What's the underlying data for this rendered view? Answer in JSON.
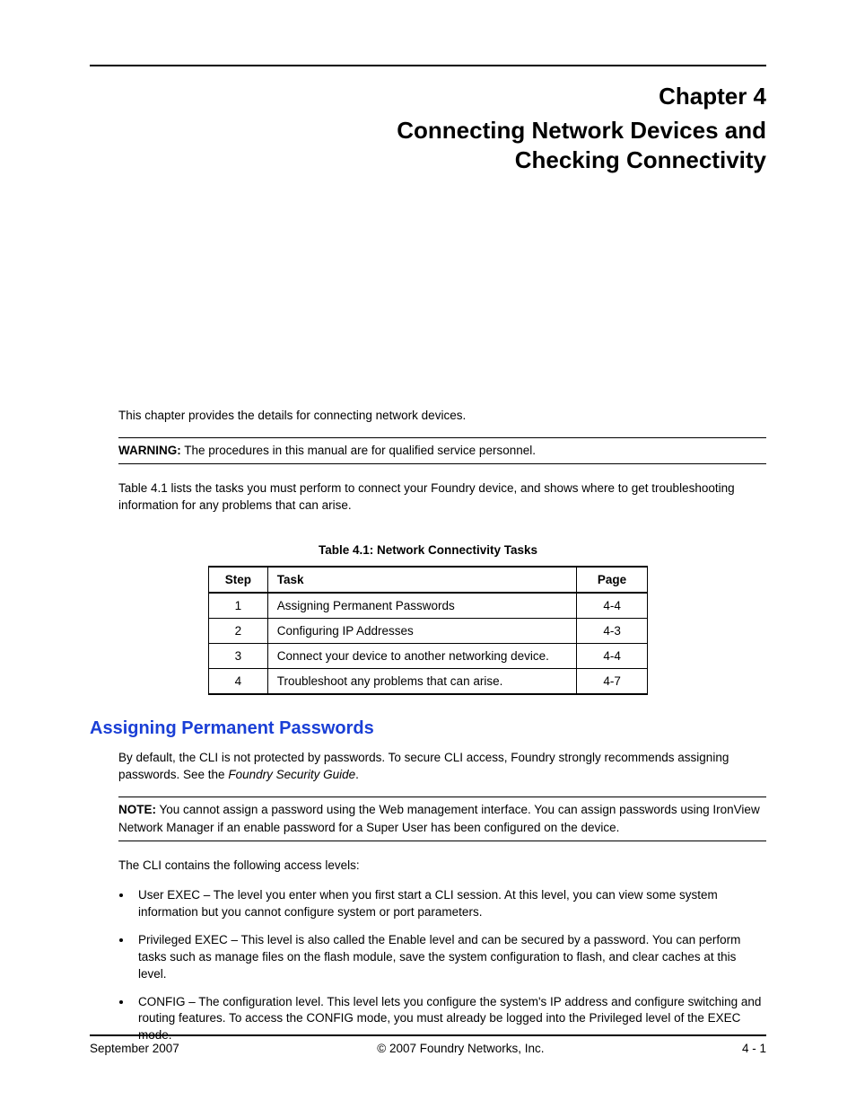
{
  "chapter": {
    "label": "Chapter 4",
    "title_line1": "Connecting Network Devices and",
    "title_line2": "Checking Connectivity"
  },
  "intro": "This chapter provides the details for connecting network devices.",
  "warning_label": "WARNING:",
  "warning_text": "The procedures in this manual are for qualified service personnel.",
  "table_intro": "Table 4.1 lists the tasks you must perform to connect your Foundry device, and shows where to get troubleshooting information for any problems that can arise.",
  "table": {
    "caption": "Table 4.1: Network Connectivity Tasks",
    "headers": {
      "step": "Step",
      "task": "Task",
      "page": "Page"
    },
    "rows": [
      {
        "step": "1",
        "task": "Assigning Permanent Passwords",
        "page": "4-4"
      },
      {
        "step": "2",
        "task": "Configuring IP Addresses",
        "page": "4-3"
      },
      {
        "step": "3",
        "task": "Connect your device to another networking device.",
        "page": "4-4"
      },
      {
        "step": "4",
        "task": "Troubleshoot any problems that can arise.",
        "page": "4-7"
      }
    ]
  },
  "section": {
    "heading": "Assigning Permanent Passwords",
    "p1_a": "By default, the CLI is not protected by passwords. To secure CLI access, Foundry strongly recommends assigning passwords.  See the ",
    "p1_i": "Foundry Security Guide",
    "p1_b": ".",
    "note_label": "NOTE:",
    "note_text": "You cannot assign a password using the Web management interface. You can assign passwords using IronView Network Manager if an enable password for a Super User has been configured on the device.",
    "p2": "The CLI contains the following access levels:",
    "bullets": [
      "User EXEC – The level you enter when you first start a CLI session. At this level, you can view some system information but you cannot configure system or port parameters.",
      "Privileged EXEC – This level is also called the Enable level and can be secured by a password. You can perform tasks such as manage files on the flash module, save the system configuration to flash, and clear caches at this level.",
      "CONFIG – The configuration level. This level lets you configure the system's IP address and configure switching and routing features. To access the CONFIG mode, you must already be logged into the Privileged level of the EXEC mode."
    ]
  },
  "footer": {
    "left": "September 2007",
    "center": "© 2007 Foundry Networks, Inc.",
    "right": "4 - 1"
  }
}
